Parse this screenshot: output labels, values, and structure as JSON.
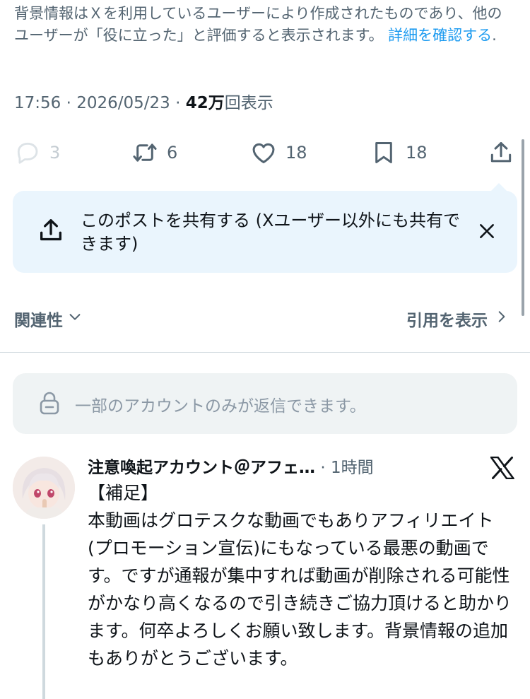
{
  "community_note": {
    "text": "背景情報はＸを利用しているユーザーにより作成されたものであり、他のユーザーが「役に立った」と評価すると表示されます。",
    "link_label": "詳細を確認する",
    "suffix": "."
  },
  "post_meta": {
    "time": "17:56",
    "separator": "·",
    "date": "2026/05/23",
    "views_count": "42万",
    "views_label": "回表示"
  },
  "actions": {
    "replies": "3",
    "reposts": "6",
    "likes": "18",
    "bookmarks": "18"
  },
  "share_popup": {
    "text": "このポストを共有する (Xユーザー以外にも共有できます)"
  },
  "sort": {
    "label": "関連性",
    "quotes_label": "引用を表示"
  },
  "reply_restriction": {
    "text": "一部のアカウントのみが返信できます。"
  },
  "reply": {
    "name": "注意喚起アカウント＠アフェ…",
    "separator": "·",
    "time": "1時間",
    "tag": "【補足】",
    "body": "本動画はグロテスクな動画でもありアフィリエイト(プロモーション宣伝)にもなっている最悪の動画です。ですが通報が集中すれば動画が削除される可能性がかなり高くなるので引き続きご協力頂けると助かります。何卒よろしくお願い致します。背景情報の追加もありがとうございます。"
  },
  "colors": {
    "accent": "#1d9bf0",
    "secondary_text": "#536471",
    "popup_bg": "#eaf5fd",
    "restriction_bg": "#eff3f4"
  },
  "icons": [
    "reply-icon",
    "repost-icon",
    "like-icon",
    "bookmark-icon",
    "share-icon",
    "close-icon",
    "chevron-down-icon",
    "chevron-right-icon",
    "lock-icon",
    "x-logo-icon"
  ]
}
